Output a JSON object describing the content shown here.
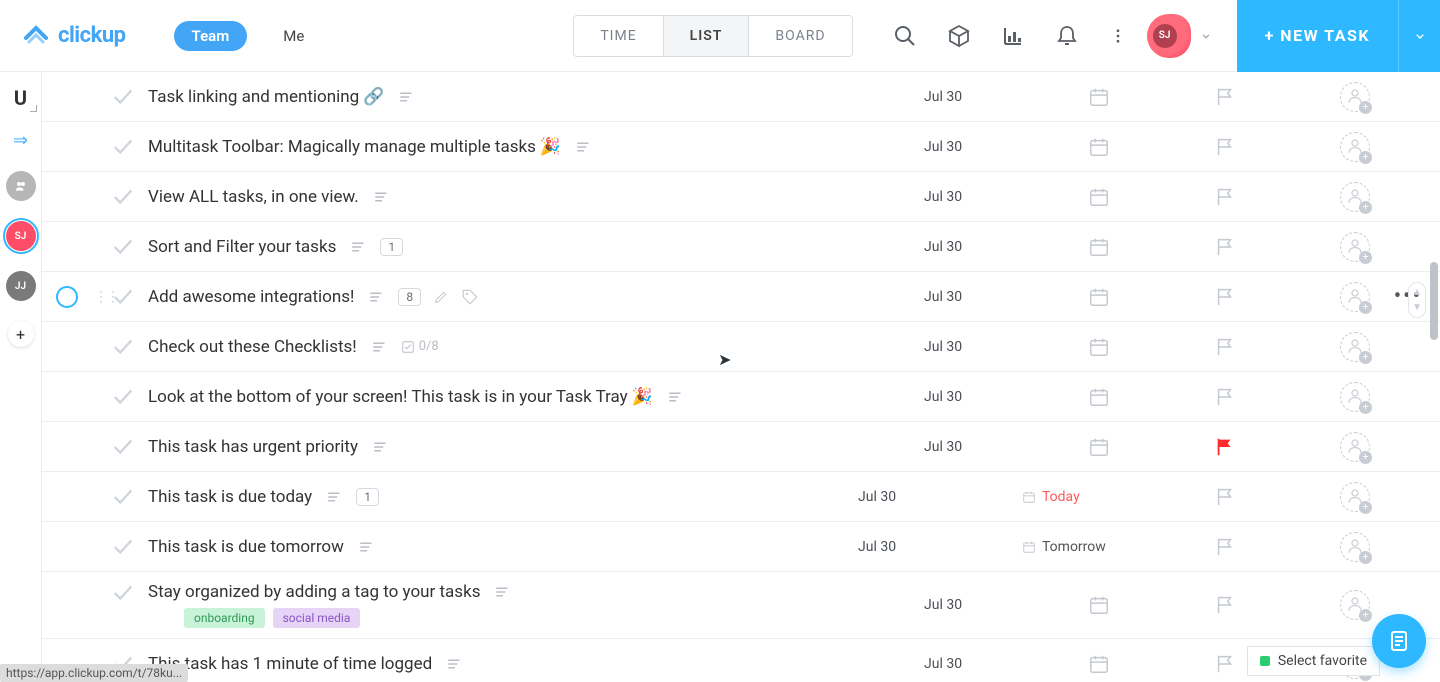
{
  "brand": "clickup",
  "nav": {
    "team": "Team",
    "me": "Me"
  },
  "views": {
    "time": "TIME",
    "list": "LIST",
    "board": "BOARD"
  },
  "newtask": "+ NEW TASK",
  "avatar": {
    "initials": "SJ"
  },
  "rail": {
    "letter": "U",
    "sj": "SJ",
    "jj": "JJ",
    "plus": "+"
  },
  "tasks": [
    {
      "title": "Task linking and mentioning",
      "emoji": "🔗",
      "created": "Jul 30"
    },
    {
      "title": "Multitask Toolbar: Magically manage multiple tasks",
      "emoji": "🎉",
      "created": "Jul 30"
    },
    {
      "title": "View ALL tasks, in one view.",
      "created": "Jul 30"
    },
    {
      "title": "Sort and Filter your tasks",
      "badge": "1",
      "created": "Jul 30"
    },
    {
      "title": "Add awesome integrations!",
      "badge": "8",
      "created": "Jul 30",
      "hovered": true
    },
    {
      "title": "Check out these Checklists!",
      "checklist": "0/8",
      "created": "Jul 30"
    },
    {
      "title": "Look at the bottom of your screen! This task is in your Task Tray",
      "emoji": "🎉",
      "created": "Jul 30"
    },
    {
      "title": "This task has urgent priority",
      "created": "Jul 30",
      "urgent": true
    },
    {
      "title": "This task is due today",
      "badge": "1",
      "created": "Jul 30",
      "due": "Today",
      "due_style": "today"
    },
    {
      "title": "This task is due tomorrow",
      "created": "Jul 30",
      "due": "Tomorrow",
      "due_style": "tomorrow"
    },
    {
      "title": "Stay organized by adding a tag to your tasks",
      "created": "Jul 30",
      "tags": [
        "onboarding",
        "social media"
      ]
    },
    {
      "title": "This task has 1 minute of time logged",
      "created": "Jul 30"
    }
  ],
  "footer": {
    "url": "https://app.clickup.com/t/78ku...",
    "favorite": "Select favorite"
  }
}
